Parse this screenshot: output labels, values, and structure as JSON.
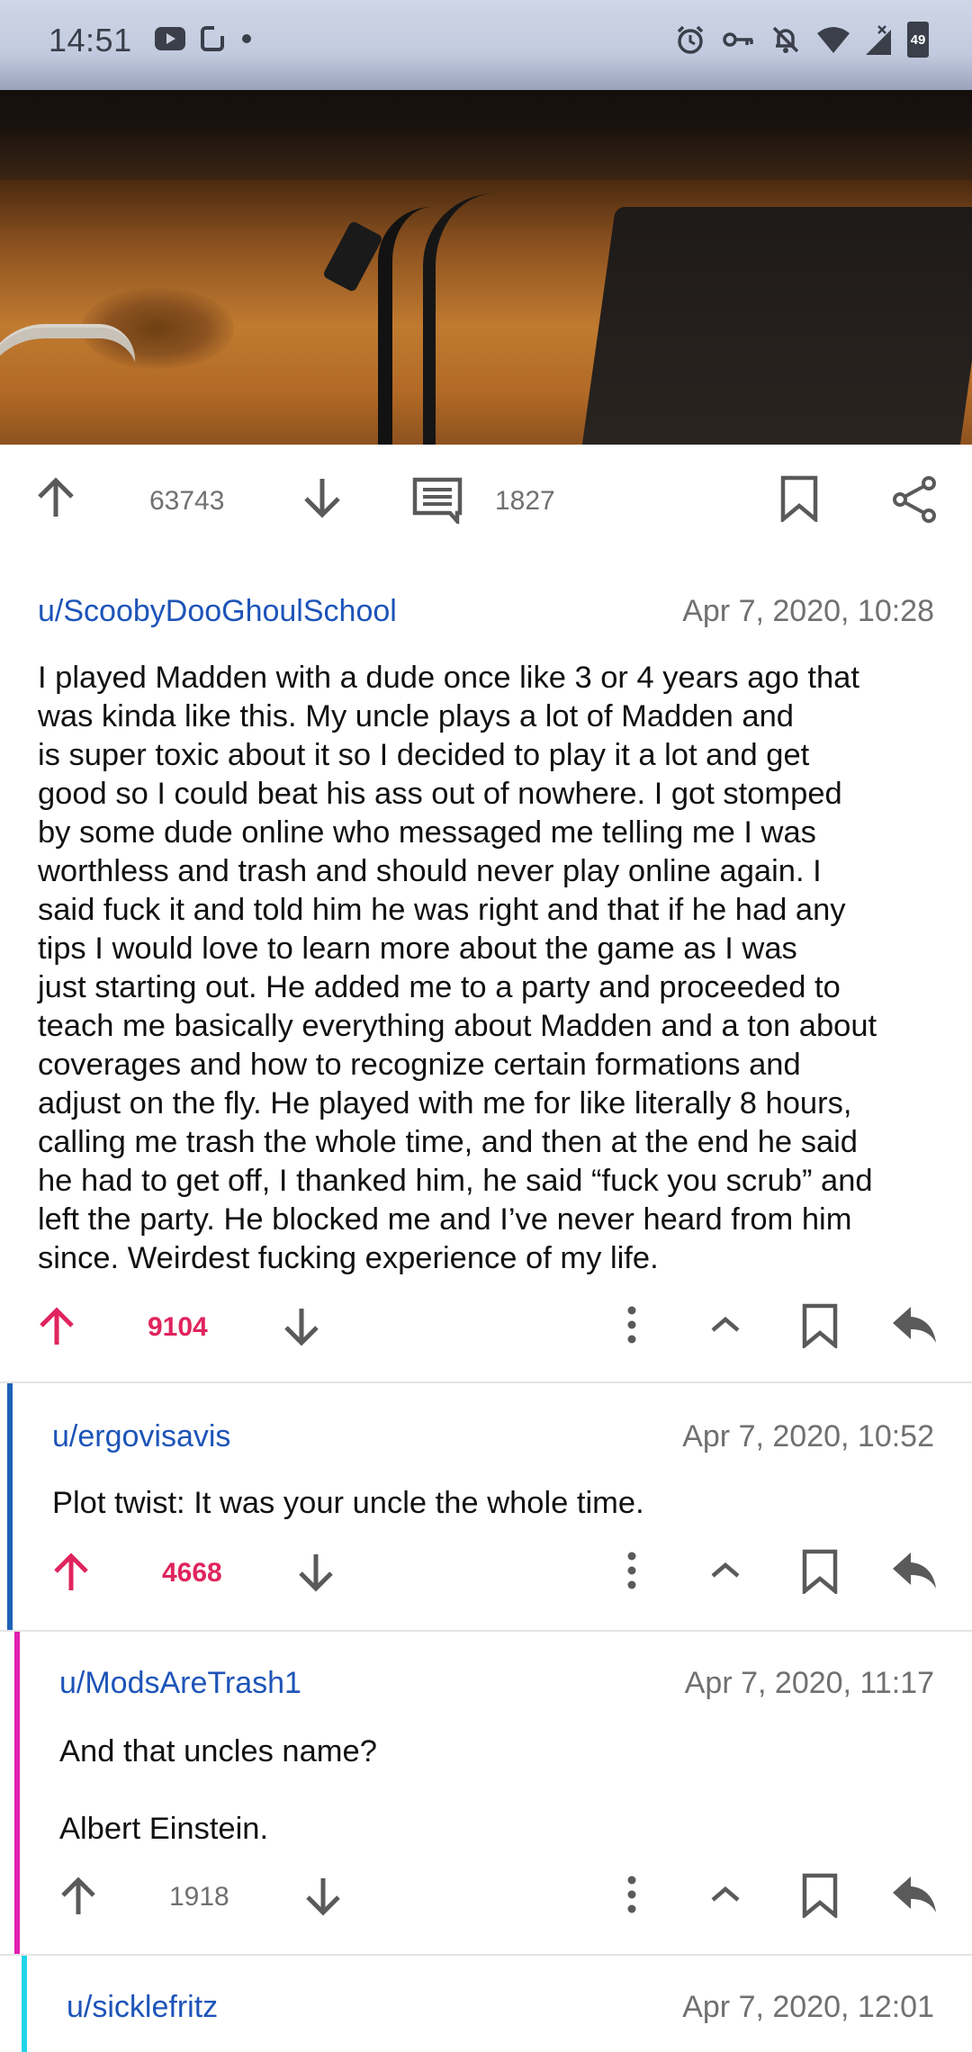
{
  "status_bar": {
    "time": "14:51",
    "battery": "49",
    "icons": [
      "youtube-icon",
      "screen-icon",
      "dot-icon",
      "alarm-icon",
      "key-icon",
      "bell-off-icon",
      "wifi-icon",
      "signal-icon",
      "battery-icon"
    ]
  },
  "post": {
    "upvotes": "63743",
    "comments": "1827"
  },
  "comments": [
    {
      "user": "u/ScoobyDooGhoulSchool",
      "date": "Apr 7, 2020, 10:28",
      "lines": [
        "I played Madden with a dude once like 3 or 4 years ago that",
        "was kinda like this. My uncle plays a lot of Madden and",
        "is super toxic about it so I decided to play it a lot and get",
        "good so I could beat his ass out of nowhere. I got stomped",
        "by some dude online who messaged me telling me I was",
        "worthless and trash and should never play online again. I",
        "said fuck it and told him he was right and that if he had any",
        "tips I would love to learn more about the game as I was",
        "just starting out. He added me to a party and proceeded to",
        "teach me basically everything about Madden and a ton about",
        "coverages and how to recognize certain formations and",
        "adjust on the fly. He played with me for like literally 8 hours,",
        "calling me trash the whole time, and then at the end he said",
        "he had to get off, I thanked him, he said “fuck you scrub” and",
        "left the party. He blocked me and I’ve never heard from him",
        "since. Weirdest fucking experience of my life."
      ],
      "score": "9104",
      "upvoted": true,
      "bar_color": ""
    },
    {
      "user": "u/ergovisavis",
      "date": "Apr 7, 2020, 10:52",
      "lines": [
        "Plot twist: It was your uncle the whole time."
      ],
      "score": "4668",
      "upvoted": true,
      "bar_color": "#1e62b8"
    },
    {
      "user": "u/ModsAreTrash1",
      "date": "Apr 7, 2020, 11:17",
      "lines": [
        "And that uncles name?",
        "Albert Einstein."
      ],
      "score": "1918",
      "upvoted": false,
      "bar_color": "#e020b0"
    },
    {
      "user": "u/sicklefritz",
      "date": "Apr 7, 2020, 12:01",
      "lines": [],
      "score": "",
      "upvoted": false,
      "bar_color": "#22d4e8"
    }
  ],
  "colors": {
    "accent_pink": "#e0245e",
    "username_blue": "#1d54b8",
    "gray": "#707070"
  }
}
